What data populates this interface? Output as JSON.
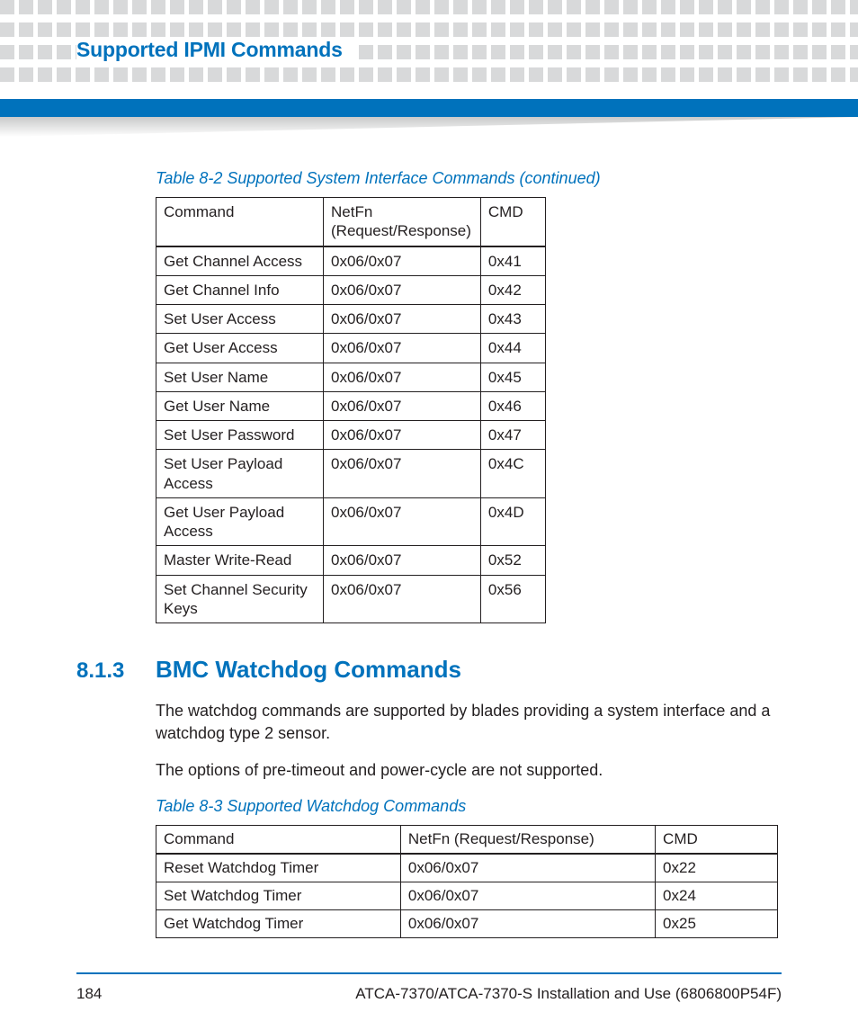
{
  "header": {
    "title": "Supported IPMI Commands"
  },
  "table82": {
    "caption": "Table 8-2 Supported System Interface Commands (continued)",
    "headers": {
      "c1": "Command",
      "c2": "NetFn (Request/Response)",
      "c3": "CMD"
    },
    "rows": [
      {
        "c1": "Get Channel Access",
        "c2": "0x06/0x07",
        "c3": "0x41"
      },
      {
        "c1": "Get Channel Info",
        "c2": "0x06/0x07",
        "c3": "0x42"
      },
      {
        "c1": "Set User Access",
        "c2": "0x06/0x07",
        "c3": "0x43"
      },
      {
        "c1": "Get User Access",
        "c2": "0x06/0x07",
        "c3": "0x44"
      },
      {
        "c1": "Set User Name",
        "c2": "0x06/0x07",
        "c3": "0x45"
      },
      {
        "c1": "Get User Name",
        "c2": "0x06/0x07",
        "c3": "0x46"
      },
      {
        "c1": "Set User Password",
        "c2": "0x06/0x07",
        "c3": "0x47"
      },
      {
        "c1": "Set User Payload Access",
        "c2": "0x06/0x07",
        "c3": "0x4C"
      },
      {
        "c1": "Get User Payload Access",
        "c2": "0x06/0x07",
        "c3": "0x4D"
      },
      {
        "c1": "Master Write-Read",
        "c2": "0x06/0x07",
        "c3": "0x52"
      },
      {
        "c1": "Set Channel Security Keys",
        "c2": "0x06/0x07",
        "c3": "0x56"
      }
    ]
  },
  "section": {
    "number": "8.1.3",
    "title": "BMC Watchdog Commands",
    "para1": "The watchdog commands are supported by blades providing a system interface and a watchdog type 2 sensor.",
    "para2": "The options of pre-timeout and power-cycle are not supported."
  },
  "table83": {
    "caption": "Table 8-3 Supported Watchdog Commands",
    "headers": {
      "c1": "Command",
      "c2": "NetFn (Request/Response)",
      "c3": "CMD"
    },
    "rows": [
      {
        "c1": "Reset Watchdog Timer",
        "c2": "0x06/0x07",
        "c3": "0x22"
      },
      {
        "c1": "Set Watchdog Timer",
        "c2": "0x06/0x07",
        "c3": "0x24"
      },
      {
        "c1": "Get Watchdog Timer",
        "c2": "0x06/0x07",
        "c3": "0x25"
      }
    ]
  },
  "footer": {
    "page": "184",
    "doc": "ATCA-7370/ATCA-7370-S Installation and Use (6806800P54F)"
  }
}
